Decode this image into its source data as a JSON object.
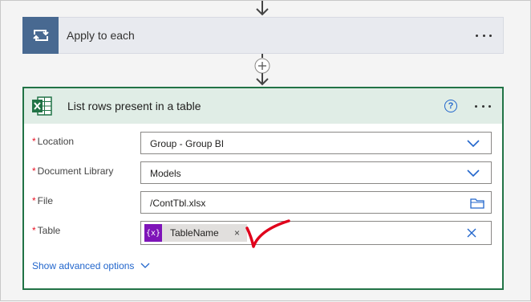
{
  "apply_card": {
    "title": "Apply to each"
  },
  "excel_card": {
    "title": "List rows present in a table",
    "help_glyph": "?",
    "fields": [
      {
        "label": "Location",
        "value": "Group - Group BI",
        "control": "dropdown"
      },
      {
        "label": "Document Library",
        "value": "Models",
        "control": "dropdown"
      },
      {
        "label": "File",
        "value": "/ContTbl.xlsx",
        "control": "file-picker"
      },
      {
        "label": "Table",
        "token_label": "TableName",
        "token_icon": "{x}",
        "token_remove": "×",
        "control": "token"
      }
    ],
    "advanced_label": "Show advanced options"
  },
  "colors": {
    "excel_green": "#217346",
    "apply_blue": "#486991",
    "token_purple": "#7e14b8",
    "link_blue": "#2266cc",
    "required_red": "#e81123",
    "annotation_red": "#e0001b"
  },
  "icons": {
    "apply": "loop-icon",
    "excel": "excel-icon",
    "add": "add-step-icon",
    "more": "more-options-icon",
    "help": "help-icon"
  }
}
